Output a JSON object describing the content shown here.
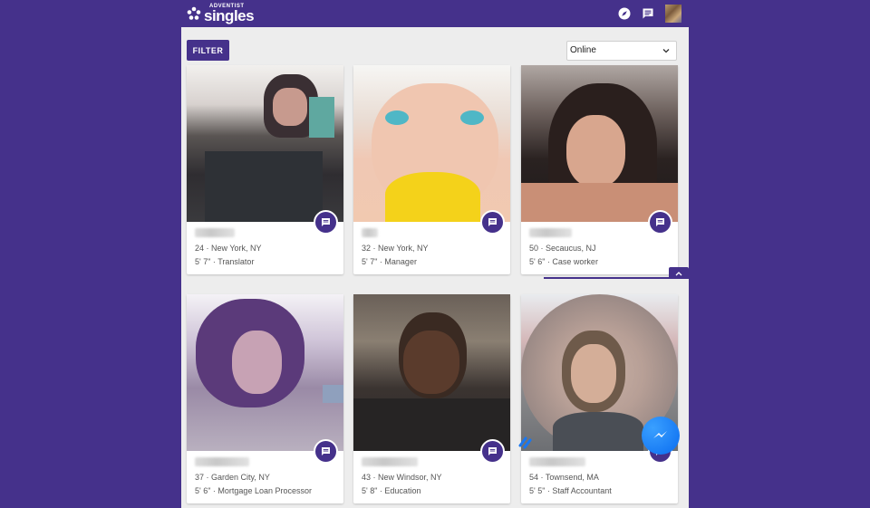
{
  "header": {
    "logo_small": "ADVENTIST",
    "logo_big": "singles",
    "icons": [
      "compass-icon",
      "chat-icon",
      "avatar"
    ]
  },
  "toolbar": {
    "filter_label": "FILTER",
    "sort_value": "Online"
  },
  "profiles": [
    {
      "age_location": "24 · New York, NY",
      "height_job": "5' 7\" · Translator"
    },
    {
      "age_location": "32 · New York, NY",
      "height_job": "5' 7\" · Manager"
    },
    {
      "age_location": "50 · Secaucus, NJ",
      "height_job": "5' 6\" · Case worker"
    },
    {
      "age_location": "37 · Garden City, NY",
      "height_job": "5' 6\" · Mortgage Loan Processor"
    },
    {
      "age_location": "43 · New Windsor, NY",
      "height_job": "5' 8\" · Education"
    },
    {
      "age_location": "54 · Townsend, MA",
      "height_job": "5' 5\" · Staff Accountant"
    }
  ],
  "colors": {
    "brand": "#45318b",
    "background": "#ededed",
    "card": "#ffffff",
    "messenger": "#0a6cf0"
  }
}
